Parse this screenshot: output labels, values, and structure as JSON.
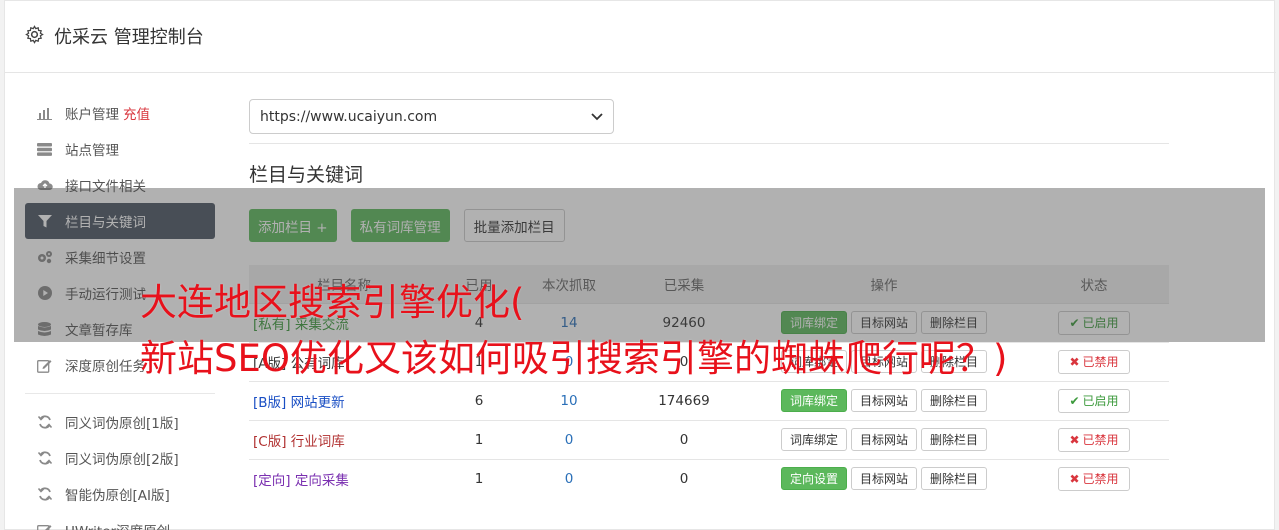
{
  "header": {
    "title": "优采云 管理控制台",
    "icon": "gear-icon"
  },
  "sidebar": {
    "items": [
      {
        "label": "账户管理",
        "extra": "充值",
        "icon": "bar-chart-icon"
      },
      {
        "label": "站点管理",
        "icon": "server-icon"
      },
      {
        "label": "接口文件相关",
        "icon": "cloud-upload-icon"
      },
      {
        "label": "栏目与关键词",
        "icon": "filter-icon",
        "active": true
      },
      {
        "label": "采集细节设置",
        "icon": "cogs-icon"
      },
      {
        "label": "手动运行测试",
        "icon": "play-circle-icon"
      },
      {
        "label": "文章暂存库",
        "icon": "database-icon"
      },
      {
        "label": "深度原创任务",
        "icon": "edit-icon"
      }
    ],
    "items2": [
      {
        "label": "同义词伪原创[1版]",
        "icon": "refresh-icon"
      },
      {
        "label": "同义词伪原创[2版]",
        "icon": "refresh-icon"
      },
      {
        "label": "智能伪原创[AI版]",
        "icon": "refresh-icon"
      },
      {
        "label": "UWriter深度原创",
        "icon": "edit-icon"
      }
    ]
  },
  "main": {
    "site_select": "https://www.ucaiyun.com",
    "section_title": "栏目与关键词",
    "buttons": {
      "add": "添加栏目 +",
      "private": "私有词库管理",
      "batch": "批量添加栏目"
    },
    "table": {
      "headers": [
        "栏目名称",
        "已用",
        "本次抓取",
        "已采集",
        "操作",
        "状态"
      ],
      "rows": [
        {
          "tag": "[私有]",
          "name": "采集交流",
          "color": "#3c9a3c",
          "used": "4",
          "fetch": "14",
          "collected": "92460",
          "op1": "词库绑定",
          "op1_green": true,
          "op2": "目标网站",
          "op3": "删除栏目",
          "status": "已启用",
          "on": true
        },
        {
          "tag": "[A版]",
          "name": "公有词库",
          "color": "#333333",
          "used": "1",
          "fetch": "0",
          "collected": "0",
          "op1": "词库绑定",
          "op1_green": false,
          "op2": "目标网站",
          "op3": "删除栏目",
          "status": "已禁用",
          "on": false
        },
        {
          "tag": "[B版]",
          "name": "网站更新",
          "color": "#1a4fc4",
          "used": "6",
          "fetch": "10",
          "collected": "174669",
          "op1": "词库绑定",
          "op1_green": true,
          "op2": "目标网站",
          "op3": "删除栏目",
          "status": "已启用",
          "on": true
        },
        {
          "tag": "[C版]",
          "name": "行业词库",
          "color": "#b03030",
          "used": "1",
          "fetch": "0",
          "collected": "0",
          "op1": "词库绑定",
          "op1_green": false,
          "op2": "目标网站",
          "op3": "删除栏目",
          "status": "已禁用",
          "on": false
        },
        {
          "tag": "[定向]",
          "name": "定向采集",
          "color": "#7a2fb0",
          "used": "1",
          "fetch": "0",
          "collected": "0",
          "op1": "定向设置",
          "op1_green": true,
          "op2": "目标网站",
          "op3": "删除栏目",
          "status": "已禁用",
          "on": false
        }
      ]
    }
  },
  "overlay": {
    "line1": "大连地区搜索引擎优化(",
    "line2": "新站SEO优化又该如何吸引搜索引擎的蜘蛛爬行呢？)"
  }
}
